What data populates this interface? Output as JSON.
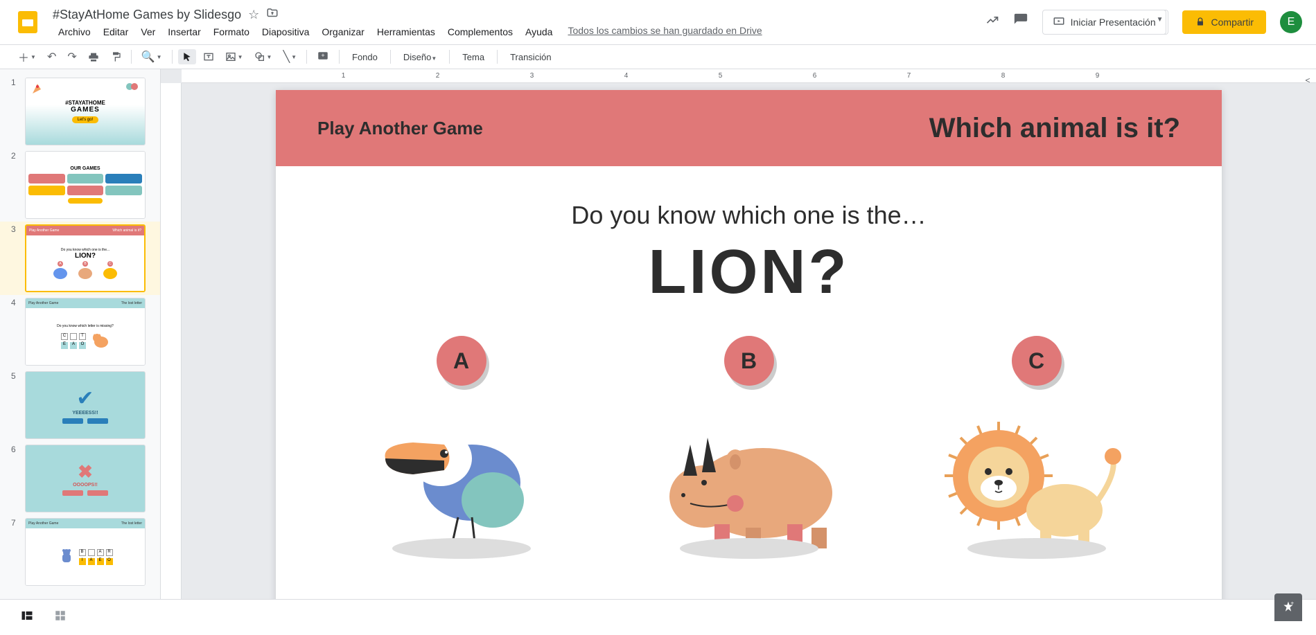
{
  "header": {
    "title": "#StayAtHome Games by Slidesgo",
    "menus": [
      "Archivo",
      "Editar",
      "Ver",
      "Insertar",
      "Formato",
      "Diapositiva",
      "Organizar",
      "Herramientas",
      "Complementos",
      "Ayuda"
    ],
    "save_status": "Todos los cambios se han guardado en Drive",
    "present": "Iniciar Presentación",
    "share": "Compartir",
    "avatar": "E"
  },
  "toolbar": {
    "fondo": "Fondo",
    "diseno": "Diseño",
    "tema": "Tema",
    "transicion": "Transición"
  },
  "ruler": [
    "1",
    "2",
    "3",
    "4",
    "5",
    "6",
    "7",
    "8",
    "9"
  ],
  "slide": {
    "play_another": "Play Another Game",
    "which_animal": "Which animal is it?",
    "question": "Do you know which one is the…",
    "answer": "LION?",
    "options": [
      "A",
      "B",
      "C"
    ]
  },
  "thumbs": {
    "t1": {
      "tag": "#STAYATHOME",
      "title": "GAMES",
      "btn": "Let's go!"
    },
    "t2": {
      "title": "OUR GAMES"
    },
    "t3": {
      "q": "Do you know which one is the...",
      "big": "LION?",
      "left": "Play Another Game",
      "right": "Which animal is it?"
    },
    "t4": {
      "left": "Play Another Game",
      "right": "The lost letter"
    },
    "t5": {
      "txt": "YEEEESS!!"
    },
    "t6": {
      "txt": "OOOOPS!!"
    },
    "t7": {
      "left": "Play Another Game",
      "right": "The lost letter"
    }
  }
}
